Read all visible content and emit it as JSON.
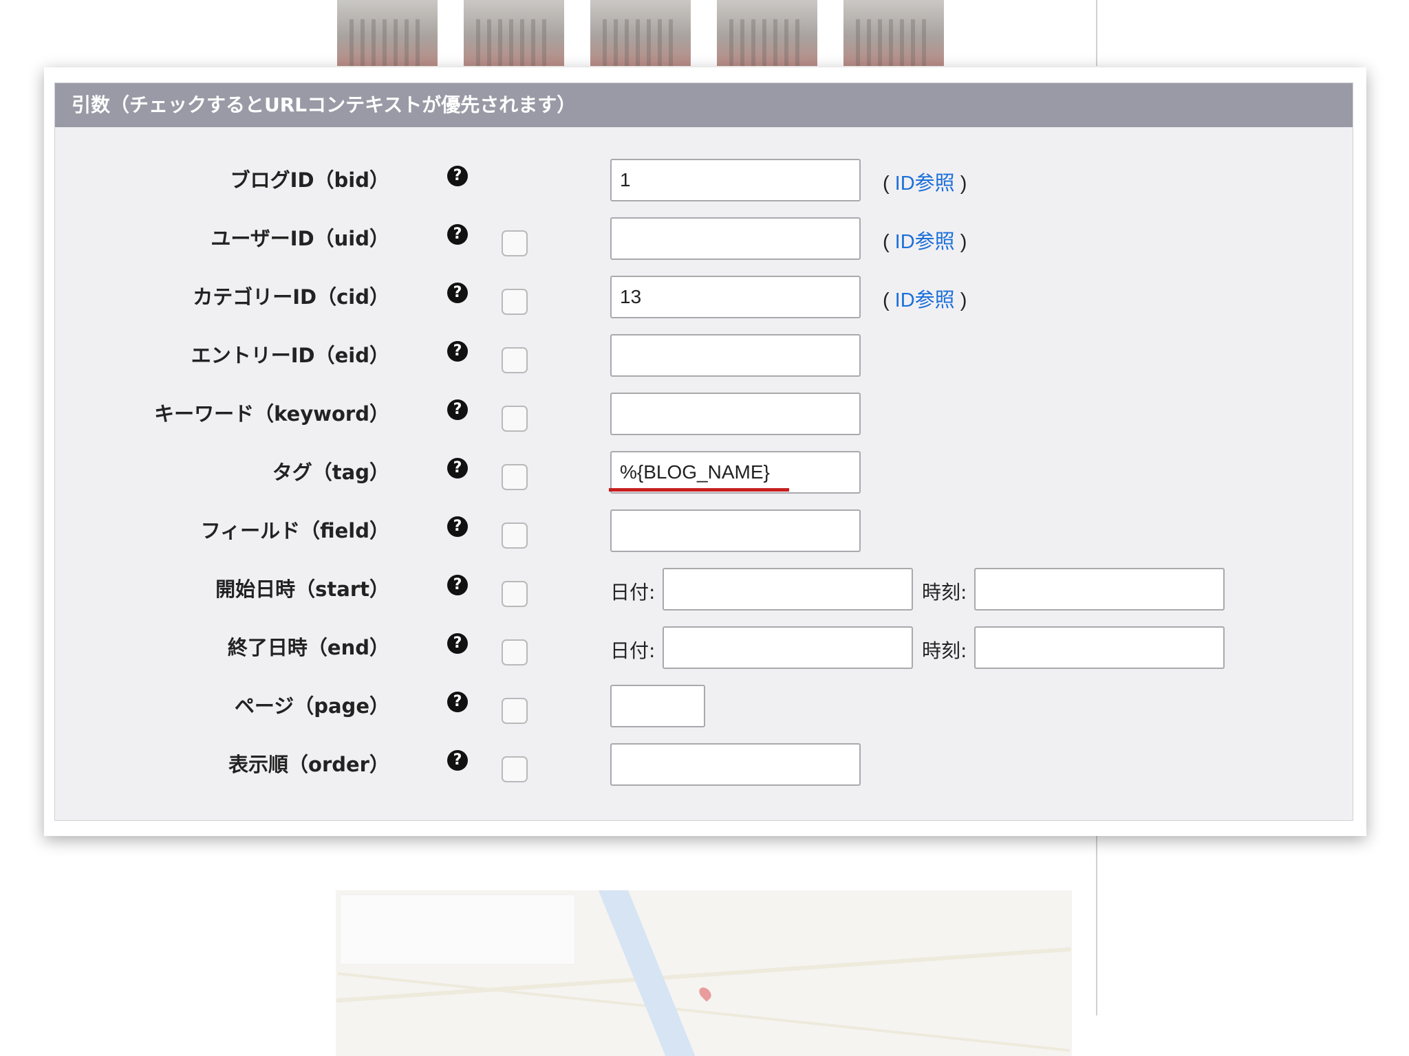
{
  "panel": {
    "title": "引数（チェックするとURLコンテキストが優先されます）"
  },
  "help_glyph": "?",
  "id_ref": {
    "open": "(",
    "link": "ID参照",
    "close": ")"
  },
  "date_label": "日付:",
  "time_label": "時刻:",
  "rows": [
    {
      "label": "ブログID（bid）",
      "value": "1",
      "has_checkbox": false,
      "has_id_ref": true
    },
    {
      "label": "ユーザーID（uid）",
      "value": "",
      "has_checkbox": true,
      "has_id_ref": true
    },
    {
      "label": "カテゴリーID（cid）",
      "value": "13",
      "has_checkbox": true,
      "has_id_ref": true
    },
    {
      "label": "エントリーID（eid）",
      "value": "",
      "has_checkbox": true
    },
    {
      "label": "キーワード（keyword）",
      "value": "",
      "has_checkbox": true
    },
    {
      "label": "タグ（tag）",
      "value": "%{BLOG_NAME}",
      "has_checkbox": true,
      "highlighted": true
    },
    {
      "label": "フィールド（field）",
      "value": "",
      "has_checkbox": true
    },
    {
      "label": "開始日時（start）",
      "date": "",
      "time": "",
      "has_checkbox": true
    },
    {
      "label": "終了日時（end）",
      "date": "",
      "time": "",
      "has_checkbox": true
    },
    {
      "label": "ページ（page）",
      "value": "",
      "has_checkbox": true
    },
    {
      "label": "表示順（order）",
      "value": "",
      "has_checkbox": true
    }
  ],
  "accent_colors": {
    "header": "#9a9aa6",
    "link": "#1c6fd9",
    "highlight_underline": "#c71f1f"
  }
}
